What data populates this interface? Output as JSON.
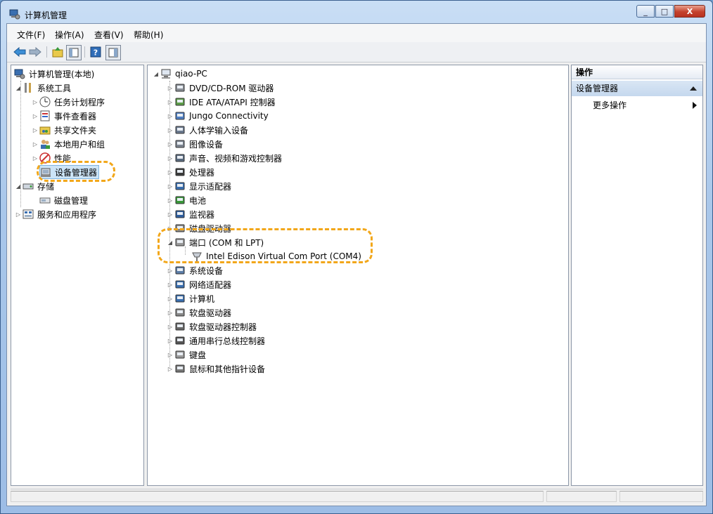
{
  "window": {
    "title": "计算机管理",
    "buttons": {
      "minimize": "_",
      "maximize": "□",
      "close": "X"
    }
  },
  "menu": [
    "文件(F)",
    "操作(A)",
    "查看(V)",
    "帮助(H)"
  ],
  "toolbar": [
    "back-icon",
    "forward-icon",
    "up-folder-icon",
    "show-hide-tree-icon",
    "help-icon",
    "properties-icon"
  ],
  "left_tree": {
    "root": "计算机管理(本地)",
    "system_tools": "系统工具",
    "items": [
      "任务计划程序",
      "事件查看器",
      "共享文件夹",
      "本地用户和组",
      "性能",
      "设备管理器"
    ],
    "storage": "存储",
    "storage_items": [
      "磁盘管理"
    ],
    "services": "服务和应用程序"
  },
  "device_tree": {
    "root": "qiao-PC",
    "categories": [
      "DVD/CD-ROM 驱动器",
      "IDE ATA/ATAPI 控制器",
      "Jungo Connectivity",
      "人体学输入设备",
      "图像设备",
      "声音、视频和游戏控制器",
      "处理器",
      "显示适配器",
      "电池",
      "监视器",
      "磁盘驱动器",
      "端口 (COM 和 LPT)",
      "系统设备",
      "网络适配器",
      "计算机",
      "软盘驱动器",
      "软盘驱动器控制器",
      "通用串行总线控制器",
      "键盘",
      "鼠标和其他指针设备"
    ],
    "port_child": "Intel Edison Virtual Com Port (COM4)"
  },
  "actions": {
    "title": "操作",
    "group": "设备管理器",
    "more": "更多操作"
  },
  "colors": {
    "highlight": "#f2a71a",
    "selection": "#cce4f7"
  }
}
